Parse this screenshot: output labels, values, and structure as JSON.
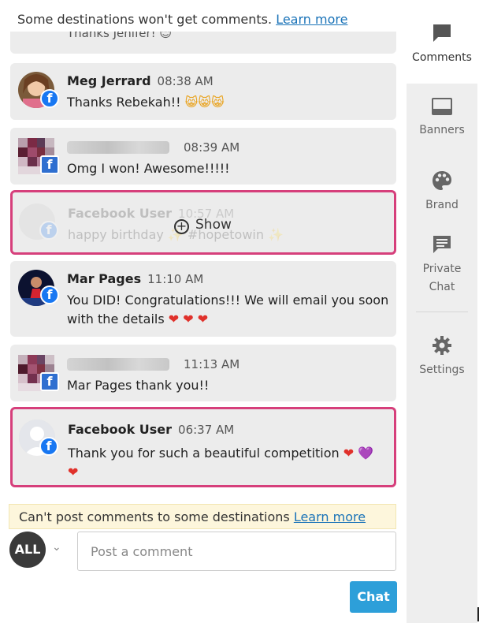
{
  "top_notice": {
    "text": "Some destinations won't get comments. ",
    "link": "Learn more"
  },
  "cut_comment": {
    "text": "Thanks Jenifer! 😊"
  },
  "comments": [
    {
      "author": "Meg Jerrard",
      "time": "08:38 AM",
      "text": "Thanks Rebekah!!",
      "emoji": "😸😸😸"
    },
    {
      "author": "",
      "time": "08:39 AM",
      "text": "Omg I won! Awesome!!!!!"
    },
    {
      "author": "Facebook User",
      "time": "10:57 AM",
      "text": "happy birthday ✨ #hopetowin ✨",
      "hidden": true,
      "show_label": "Show"
    },
    {
      "author": "Mar Pages",
      "time": "11:10 AM",
      "text": "You DID! Congratulations!!! We will email you soon with the details",
      "emoji": "❤ ❤ ❤"
    },
    {
      "author": "",
      "time": "11:13 AM",
      "text": "Mar Pages thank you!!"
    },
    {
      "author": "Facebook User",
      "time": "06:37 AM",
      "text": "Thank you for such a beautiful competition",
      "emoji_red": "❤",
      "emoji_purple": "💜",
      "emoji_line2": "❤"
    }
  ],
  "bottom_notice": {
    "text": "Can't post comments to some destinations ",
    "link": "Learn more"
  },
  "composer": {
    "all_label": "ALL",
    "placeholder": "Post a comment",
    "send_label": "Chat"
  },
  "sidebar": {
    "items": [
      {
        "label": "Comments",
        "icon": "comment-icon",
        "active": true
      },
      {
        "label": "Banners",
        "icon": "banner-icon"
      },
      {
        "label": "Brand",
        "icon": "palette-icon"
      },
      {
        "label": "Private Chat",
        "icon": "private-chat-icon"
      },
      {
        "label": "Settings",
        "icon": "gear-icon"
      }
    ]
  },
  "colors": {
    "accent": "#2d9fd9",
    "highlight": "#d63f7b",
    "facebook": "#1877f2",
    "link": "#1a73b8"
  }
}
